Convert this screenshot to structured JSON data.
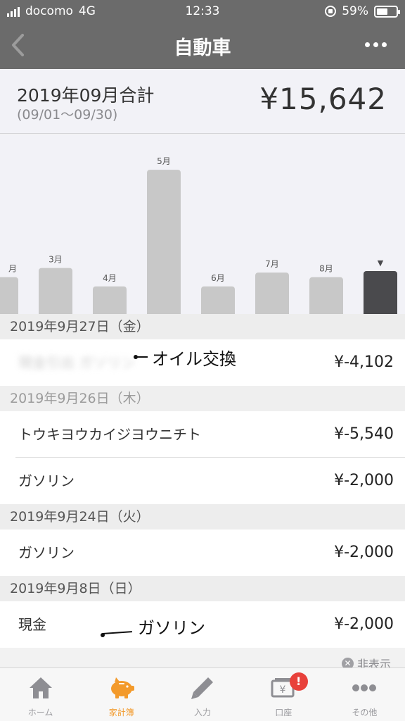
{
  "status_bar": {
    "carrier": "docomo",
    "network": "4G",
    "time": "12:33",
    "battery": "59%",
    "battery_level": 0.59
  },
  "nav": {
    "title": "自動車",
    "back_icon": "chevron-left-icon",
    "more_icon": "more-icon"
  },
  "summary": {
    "label": "2019年09月合計",
    "range": "(09/01〜09/30)",
    "total": "¥15,642"
  },
  "chart_data": {
    "type": "bar",
    "categories": [
      "",
      "3月",
      "4月",
      "5月",
      "6月",
      "7月",
      "8月",
      ""
    ],
    "first_label_fragment": "月",
    "selected_marker": "▼",
    "values": [
      0.24,
      0.3,
      0.18,
      0.94,
      0.18,
      0.27,
      0.24,
      0.28
    ],
    "value_units": "relative (no axis shown)",
    "colors": {
      "bar": "#c8c8c8",
      "selected": "#4a4a4d"
    }
  },
  "groups": [
    {
      "date": "2019年9月27日（金）",
      "items": [
        {
          "name": "現金引出 ガソリン",
          "amount": "¥-4,102",
          "annotation": "オイル交換",
          "blurred": true
        }
      ]
    },
    {
      "date": "2019年9月26日（木）",
      "faded": true,
      "items": [
        {
          "name": "トウキヨウカイジヨウニチト",
          "amount": "¥-5,540"
        },
        {
          "name": "ガソリン",
          "amount": "¥-2,000"
        }
      ]
    },
    {
      "date": "2019年9月24日（火）",
      "items": [
        {
          "name": "ガソリン",
          "amount": "¥-2,000"
        }
      ]
    },
    {
      "date": "2019年9月8日（日）",
      "items": [
        {
          "name": "現金",
          "amount": "¥-2,000",
          "annotation": "ガソリン"
        }
      ]
    }
  ],
  "hide_label": "非表示",
  "tabs": [
    {
      "label": "ホーム",
      "icon": "home-icon"
    },
    {
      "label": "家計簿",
      "icon": "piggy-bank-icon",
      "active": true
    },
    {
      "label": "入力",
      "icon": "pencil-icon"
    },
    {
      "label": "口座",
      "icon": "wallet-icon",
      "badge": "!"
    },
    {
      "label": "その他",
      "icon": "more-icon"
    }
  ]
}
